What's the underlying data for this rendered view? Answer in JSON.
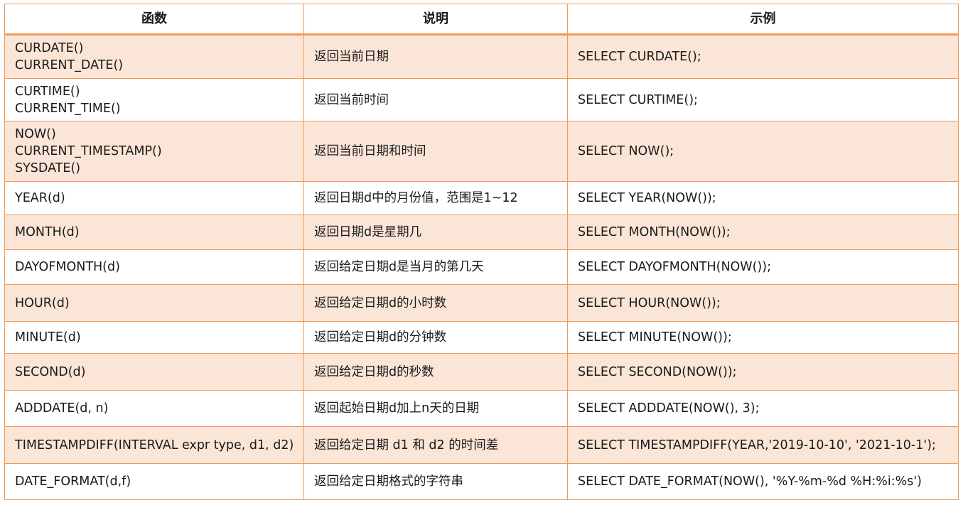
{
  "header": {
    "col_function": "函数",
    "col_description": "说明",
    "col_example": "示例"
  },
  "rows": [
    {
      "function": [
        "CURDATE()",
        "CURRENT_DATE()"
      ],
      "description": "返回当前日期",
      "example": "SELECT CURDATE();"
    },
    {
      "function": [
        "CURTIME()",
        "CURRENT_TIME()"
      ],
      "description": "返回当前时间",
      "example": "SELECT CURTIME();"
    },
    {
      "function": [
        "NOW()",
        "CURRENT_TIMESTAMP()",
        "SYSDATE()"
      ],
      "description": "返回当前日期和时间",
      "example": "SELECT NOW();"
    },
    {
      "function": [
        "YEAR(d)"
      ],
      "description": "返回日期d中的月份值，范围是1~12",
      "example": "SELECT YEAR(NOW());"
    },
    {
      "function": [
        "MONTH(d)"
      ],
      "description": "返回日期d是星期几",
      "example": "SELECT MONTH(NOW());"
    },
    {
      "function": [
        "DAYOFMONTH(d)"
      ],
      "description": "返回给定日期d是当月的第几天",
      "example": "SELECT DAYOFMONTH(NOW());"
    },
    {
      "function": [
        "HOUR(d)"
      ],
      "description": "返回给定日期d的小时数",
      "example": "SELECT HOUR(NOW());"
    },
    {
      "function": [
        "MINUTE(d)"
      ],
      "description": "返回给定日期d的分钟数",
      "example": "SELECT MINUTE(NOW());"
    },
    {
      "function": [
        "SECOND(d)"
      ],
      "description": "返回给定日期d的秒数",
      "example": "SELECT SECOND(NOW());"
    },
    {
      "function": [
        "ADDDATE(d, n)"
      ],
      "description": "返回起始日期d加上n天的日期",
      "example": "SELECT ADDDATE(NOW(), 3);"
    },
    {
      "function": [
        "TIMESTAMPDIFF(INTERVAL expr type, d1, d2)"
      ],
      "description": "返回给定日期 d1 和 d2 的时间差",
      "example": "SELECT TIMESTAMPDIFF(YEAR,'2019-10-10', '2021-10-1');"
    },
    {
      "function": [
        "DATE_FORMAT(d,f)"
      ],
      "description": "返回给定日期格式的字符串",
      "example": "SELECT DATE_FORMAT(NOW(), '%Y-%m-%d  %H:%i:%s')"
    }
  ],
  "colors": {
    "border": "#ee9a5a",
    "row_shade": "#fbe5d7",
    "row_plain": "#ffffff"
  }
}
